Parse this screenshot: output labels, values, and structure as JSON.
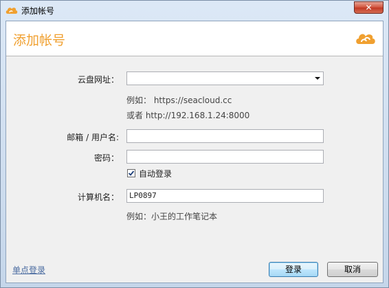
{
  "window": {
    "title": "添加帐号",
    "close_glyph": "✕"
  },
  "header": {
    "title": "添加帐号",
    "logo_icon": "seafile-cloud-logo-icon",
    "accent_color": "#f0a030"
  },
  "form": {
    "server_label": "云盘网址：",
    "server_value": "",
    "server_hint_1": "例如： https://seacloud.cc",
    "server_hint_2": "或者 http://192.168.1.24:8000",
    "email_label": "邮箱 / 用户名:",
    "email_value": "",
    "password_label": "密码：",
    "password_value": "",
    "auto_login_label": "自动登录",
    "auto_login_checked": true,
    "computer_label": "计算机名：",
    "computer_value": "LP0897",
    "computer_hint": "例如：小王的工作笔记本"
  },
  "footer": {
    "sso_link": "单点登录",
    "login_button": "登录",
    "cancel_button": "取消"
  }
}
